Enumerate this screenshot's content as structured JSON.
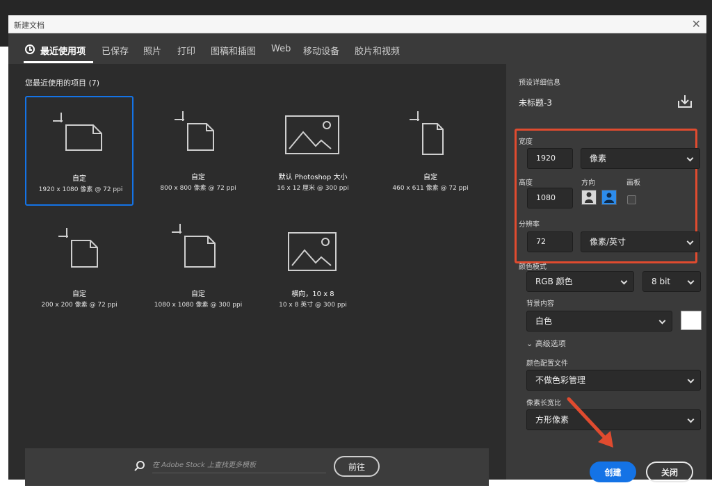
{
  "window": {
    "title": "新建文档",
    "close_glyph": "✕"
  },
  "tabs": [
    {
      "label": "最近使用项",
      "active": true
    },
    {
      "label": "已保存"
    },
    {
      "label": "照片"
    },
    {
      "label": "打印"
    },
    {
      "label": "图稿和插图"
    },
    {
      "label": "Web"
    },
    {
      "label": "移动设备"
    },
    {
      "label": "胶片和视频"
    }
  ],
  "recent": {
    "title": "您最近使用的项目 (7)",
    "items": [
      {
        "name": "自定",
        "dims": "1920 x 1080 像素 @ 72 ppi",
        "icon": "custom-document-icon",
        "selected": true
      },
      {
        "name": "自定",
        "dims": "800 x 800 像素 @ 72 ppi",
        "icon": "custom-document-icon"
      },
      {
        "name": "默认 Photoshop 大小",
        "dims": "16 x 12 厘米 @ 300 ppi",
        "icon": "image-document-icon"
      },
      {
        "name": "自定",
        "dims": "460 x 611 像素 @ 72 ppi",
        "icon": "custom-document-icon"
      },
      {
        "name": "自定",
        "dims": "200 x 200 像素 @ 72 ppi",
        "icon": "custom-document-icon"
      },
      {
        "name": "自定",
        "dims": "1080 x 1080 像素 @ 300 ppi",
        "icon": "custom-document-icon"
      },
      {
        "name": "横向，10 x 8",
        "dims": "10 x 8 英寸 @ 300 ppi",
        "icon": "image-document-icon"
      }
    ]
  },
  "search": {
    "placeholder": "在 Adobe Stock 上查找更多模板",
    "go_label": "前往"
  },
  "details": {
    "heading": "预设详细信息",
    "doc_name": "未标题-3",
    "width_label": "宽度",
    "width_value": "1920",
    "width_unit": "像素",
    "height_label": "高度",
    "height_value": "1080",
    "orientation_label": "方向",
    "artboard_label": "画板",
    "resolution_label": "分辨率",
    "resolution_value": "72",
    "resolution_unit": "像素/英寸",
    "color_mode_label": "颜色模式",
    "color_mode": "RGB 颜色",
    "bit_depth": "8 bit",
    "background_label": "背景内容",
    "background": "白色",
    "background_swatch": "#ffffff",
    "advanced_label": "高级选项",
    "profile_label": "颜色配置文件",
    "profile": "不做色彩管理",
    "aspect_label": "像素长宽比",
    "aspect": "方形像素",
    "create_label": "创建",
    "close_label": "关闭"
  },
  "colors": {
    "accent": "#1473e6",
    "highlight": "#e04b2f"
  }
}
